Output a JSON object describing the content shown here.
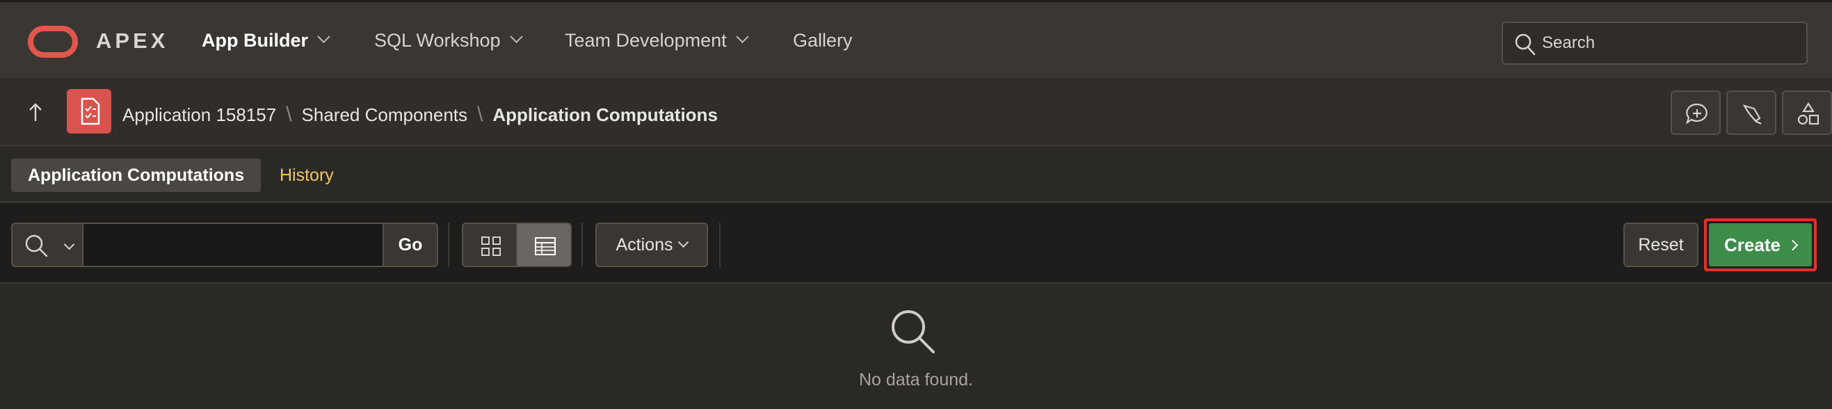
{
  "brand": {
    "name": "APEX",
    "accent": "#e2574c"
  },
  "nav": [
    {
      "label": "App Builder",
      "active": true,
      "has_dropdown": true
    },
    {
      "label": "SQL Workshop",
      "active": false,
      "has_dropdown": true
    },
    {
      "label": "Team Development",
      "active": false,
      "has_dropdown": true
    },
    {
      "label": "Gallery",
      "active": false,
      "has_dropdown": false
    }
  ],
  "search": {
    "placeholder": "Search",
    "value": ""
  },
  "breadcrumb": {
    "items": [
      "Application 158157",
      "Shared Components"
    ],
    "current": "Application Computations"
  },
  "toolbar_icons": [
    "add-comment-icon",
    "highlighter-icon",
    "shapes-icon"
  ],
  "tabs": [
    {
      "label": "Application Computations",
      "active": true
    },
    {
      "label": "History",
      "active": false
    }
  ],
  "report_toolbar": {
    "search_value": "",
    "go_label": "Go",
    "actions_label": "Actions",
    "reset_label": "Reset",
    "create_label": "Create",
    "create_color": "#3e8c49",
    "highlight_color": "#e0332b"
  },
  "empty_state": {
    "message": "No data found.",
    "icon": "search-icon"
  }
}
